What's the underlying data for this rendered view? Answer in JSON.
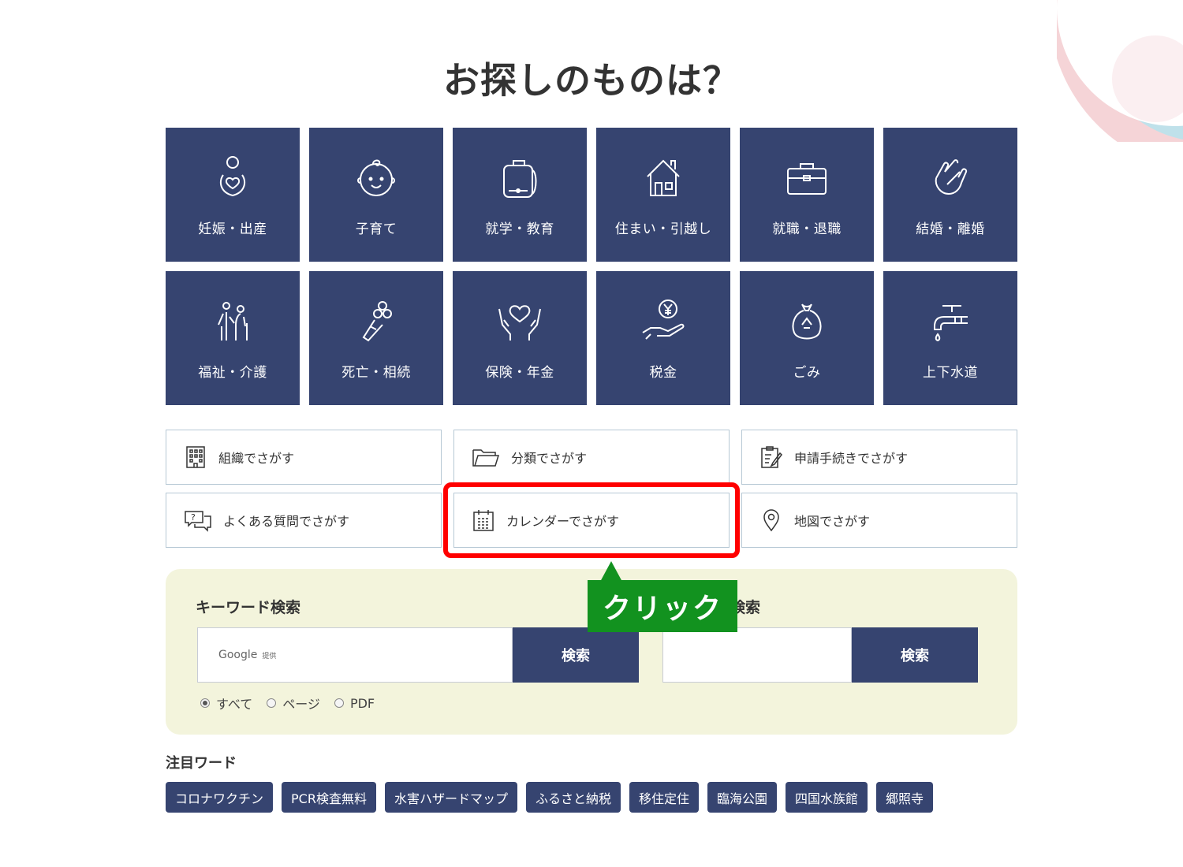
{
  "page": {
    "title": "お探しのものは？"
  },
  "categories": [
    {
      "label": "妊娠・出産",
      "icon": "pregnancy-icon"
    },
    {
      "label": "子育て",
      "icon": "baby-icon"
    },
    {
      "label": "就学・教育",
      "icon": "school-bag-icon"
    },
    {
      "label": "住まい・引越し",
      "icon": "house-icon"
    },
    {
      "label": "就職・退職",
      "icon": "briefcase-icon"
    },
    {
      "label": "結婚・離婚",
      "icon": "handshake-icon"
    },
    {
      "label": "福祉・介護",
      "icon": "elderly-care-icon"
    },
    {
      "label": "死亡・相続",
      "icon": "flowers-icon"
    },
    {
      "label": "保険・年金",
      "icon": "heart-hands-icon"
    },
    {
      "label": "税金",
      "icon": "yen-hand-icon"
    },
    {
      "label": "ごみ",
      "icon": "recycle-bag-icon"
    },
    {
      "label": "上下水道",
      "icon": "faucet-icon"
    }
  ],
  "search_links": [
    {
      "label": "組織でさがす",
      "icon": "building-icon"
    },
    {
      "label": "分類でさがす",
      "icon": "folder-icon"
    },
    {
      "label": "申請手続きでさがす",
      "icon": "form-edit-icon"
    },
    {
      "label": "よくある質問でさがす",
      "icon": "faq-chat-icon"
    },
    {
      "label": "カレンダーでさがす",
      "icon": "calendar-icon"
    },
    {
      "label": "地図でさがす",
      "icon": "map-pin-icon"
    }
  ],
  "keyword_search": {
    "label": "キーワード検索",
    "google_text": "Google",
    "google_sub": "提供",
    "button": "検索",
    "radios": [
      {
        "label": "すべて",
        "checked": true
      },
      {
        "label": "ページ",
        "checked": false
      },
      {
        "label": "PDF",
        "checked": false
      }
    ]
  },
  "second_search": {
    "label_fragment": "検索",
    "button": "検索"
  },
  "callout": {
    "text": "クリック"
  },
  "hot_words": {
    "title": "注目ワード",
    "tags": [
      "コロナワクチン",
      "PCR検査無料",
      "水害ハザードマップ",
      "ふるさと納税",
      "移住定住",
      "臨海公園",
      "四国水族館",
      "郷照寺"
    ]
  },
  "colors": {
    "navy": "#364470",
    "panel_bg": "#f3f4dc",
    "highlight": "#ff0000",
    "callout": "#12921f"
  }
}
